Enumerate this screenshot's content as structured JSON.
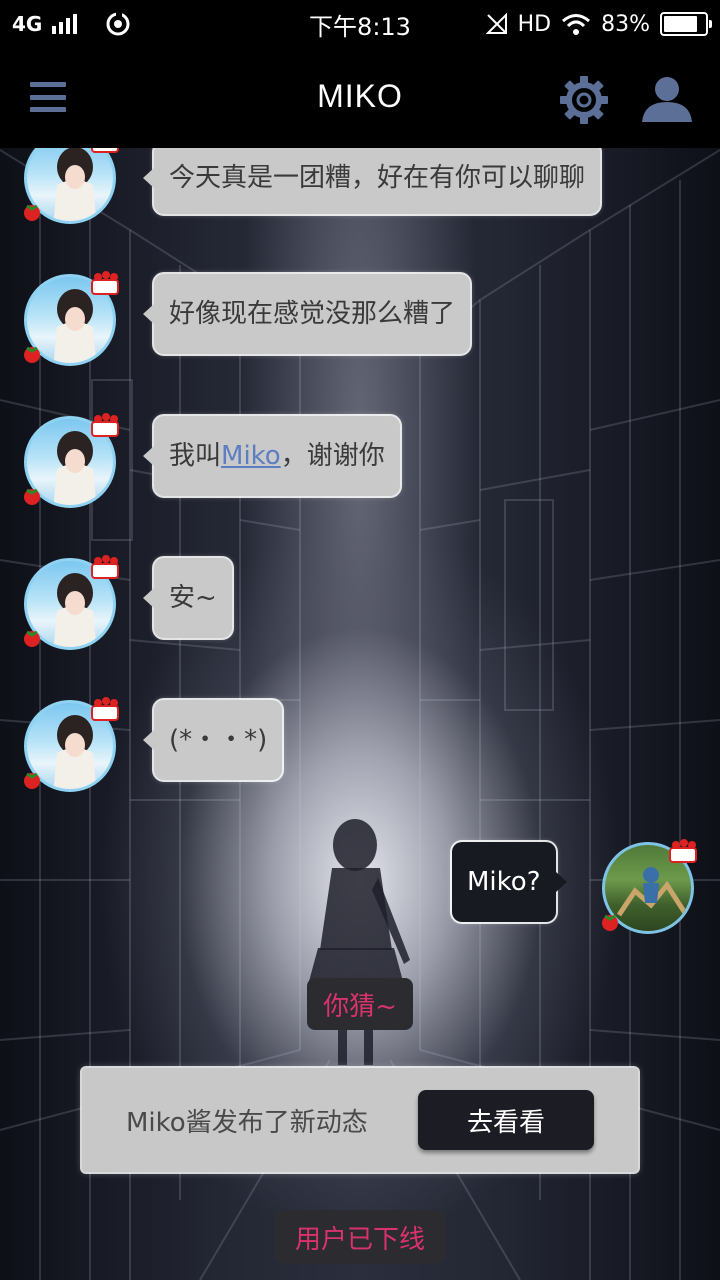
{
  "status_bar": {
    "network": "4G",
    "time": "下午8:13",
    "hd": "HD",
    "battery": "83%",
    "battery_level": 0.83
  },
  "header": {
    "title": "MIKO",
    "menu_icon": "hamburger-menu-icon",
    "settings_icon": "gear-icon",
    "profile_icon": "person-icon"
  },
  "messages": [
    {
      "sender": "bot",
      "text": "今天真是一团糟，好在有你可以聊聊"
    },
    {
      "sender": "bot",
      "text": "好像现在感觉没那么糟了"
    },
    {
      "sender": "bot",
      "text_before": "我叫",
      "link": "Miko",
      "text_after": "，谢谢你"
    },
    {
      "sender": "bot",
      "text": "安~"
    },
    {
      "sender": "bot",
      "text": "(*・・*)"
    },
    {
      "sender": "user",
      "text": "Miko?"
    }
  ],
  "reply_tag": "你猜~",
  "notification": {
    "text": "Miko酱发布了新动态",
    "button": "去看看"
  },
  "offline_tag": "用户已下线",
  "colors": {
    "header_bg": "#000000",
    "icon_blue": "#5c6f96",
    "bot_bubble": "#c9c9c9",
    "user_bubble": "#181a22",
    "pill_text": "#d8336a",
    "link": "#5d7fc1"
  }
}
